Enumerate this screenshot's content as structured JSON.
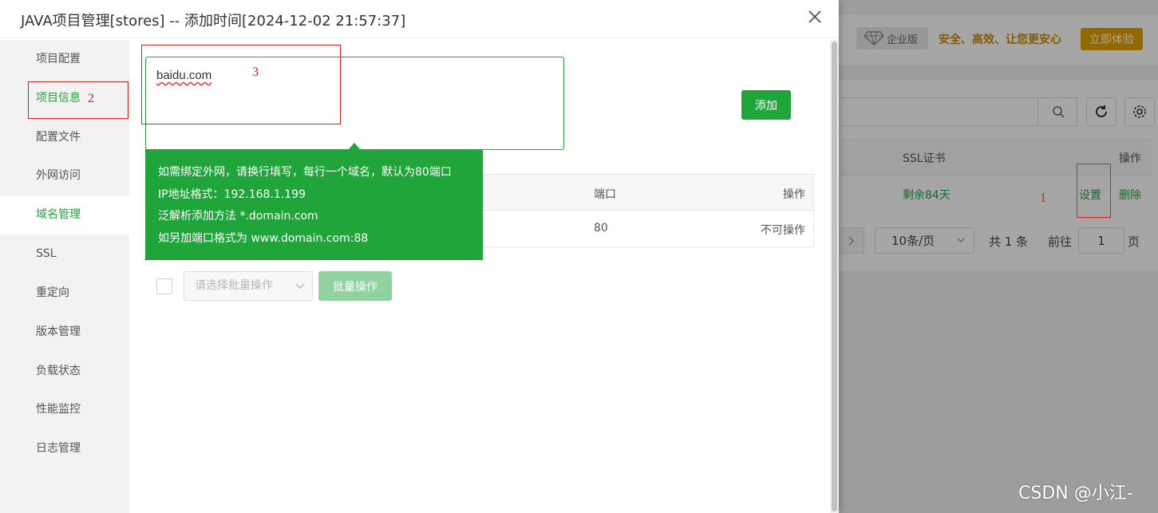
{
  "background": {
    "enterprise_badge": "企业版",
    "slogan": "安全、高效、让您更安心",
    "try_button": "立即体验",
    "table_headers": {
      "ssl": "SSL证书",
      "operation": "操作"
    },
    "row": {
      "ssl_remaining": "剩余84天",
      "setting": "设置",
      "delete": "删除"
    },
    "pagination": {
      "page_size": "10条/页",
      "total": "共 1 条",
      "goto": "前往",
      "page_input": "1",
      "page_suffix": "页"
    }
  },
  "dialog": {
    "title": "JAVA项目管理[stores] -- 添加时间[2024-12-02 21:57:37]",
    "sidebar": {
      "items": [
        {
          "label": "项目配置"
        },
        {
          "label": "项目信息"
        },
        {
          "label": "配置文件"
        },
        {
          "label": "外网访问"
        },
        {
          "label": "域名管理"
        },
        {
          "label": "SSL"
        },
        {
          "label": "重定向"
        },
        {
          "label": "版本管理"
        },
        {
          "label": "负载状态"
        },
        {
          "label": "性能监控"
        },
        {
          "label": "日志管理"
        }
      ],
      "active": "域名管理"
    },
    "domain_input": {
      "value": "baidu.com"
    },
    "add_button": "添加",
    "tooltip": {
      "lines": [
        "如需绑定外网，请换行填写，每行一个域名，默认为80端口",
        "IP地址格式：192.168.1.199",
        "泛解析添加方法 *.domain.com",
        "如另加端口格式为 www.domain.com:88"
      ]
    },
    "table": {
      "headers": {
        "port": "端口",
        "operation": "操作"
      },
      "rows": [
        {
          "port": "80",
          "operation": "不可操作"
        }
      ]
    },
    "batch": {
      "placeholder": "请选择批量操作",
      "button": "批量操作"
    }
  },
  "annotations": {
    "n1": "1",
    "n2": "2",
    "n3": "3"
  },
  "watermark": "CSDN @小江-",
  "colors": {
    "accent": "#20a53a",
    "annotation": "#e02020",
    "gold": "#e0a100"
  }
}
